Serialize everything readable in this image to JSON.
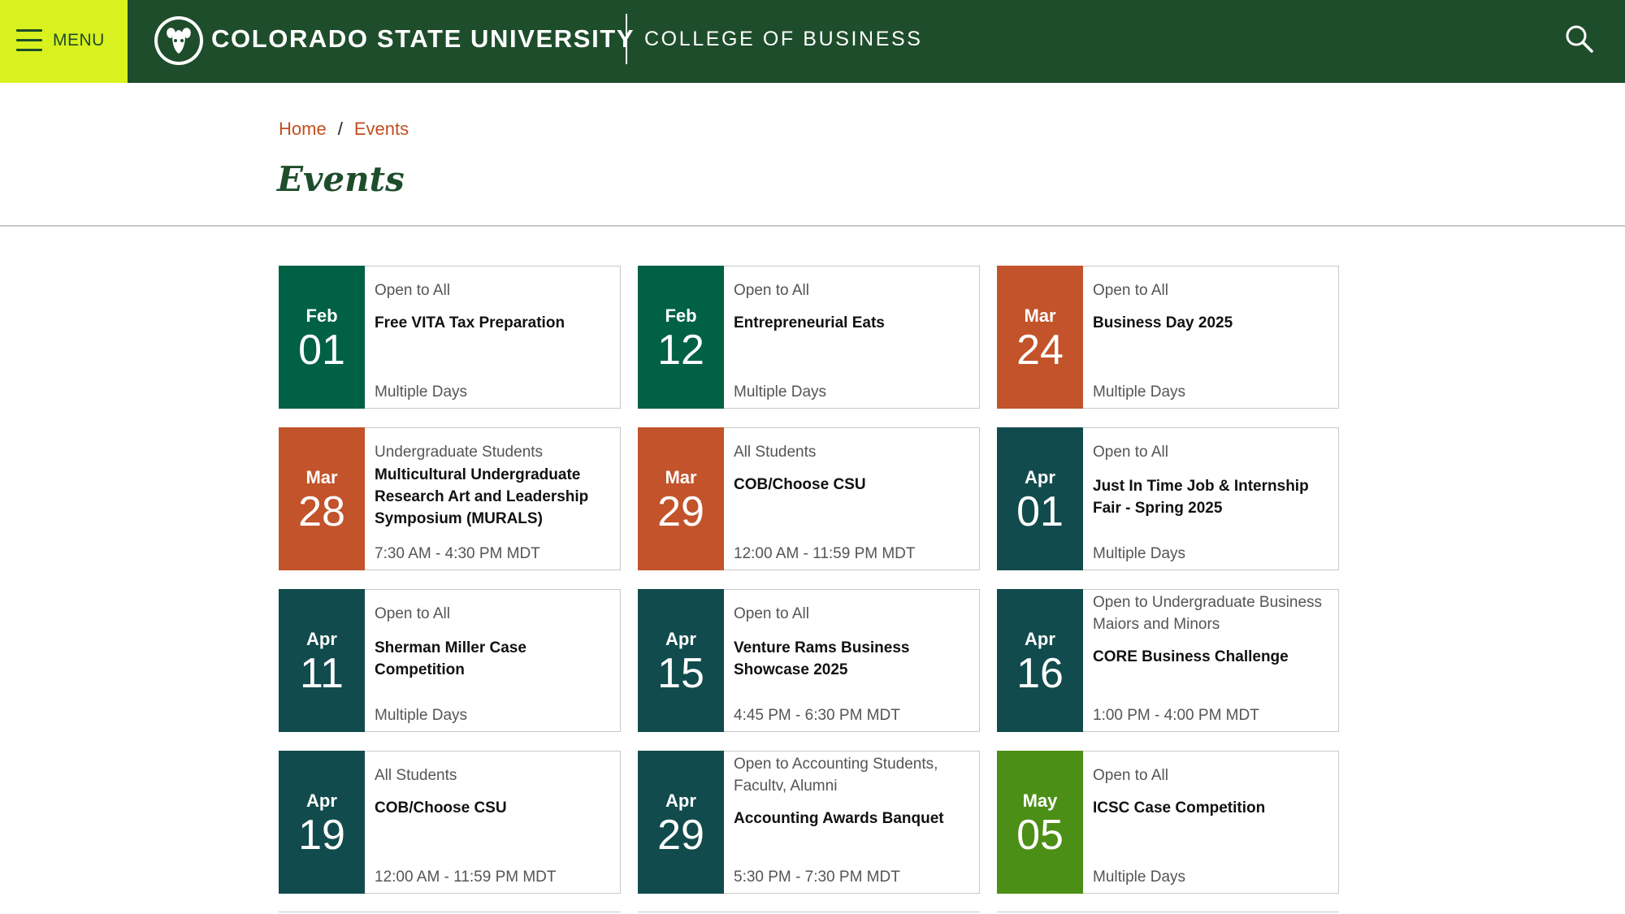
{
  "header": {
    "menu_label": "MENU",
    "university": "COLORADO STATE UNIVERSITY",
    "college": "COLLEGE OF BUSINESS",
    "icons": {
      "menu": "hamburger-icon",
      "logo": "ram-logo-icon",
      "search": "search-icon"
    },
    "colors": {
      "bar": "#1e4d2b",
      "menu_bg": "#d9f11e"
    }
  },
  "breadcrumb": {
    "home": "Home",
    "separator": "/",
    "current": "Events"
  },
  "page_title": "Events",
  "colors": {
    "green": "#006144",
    "orange": "#c2532a",
    "teal": "#124b4d",
    "lime": "#4c8f16"
  },
  "events": [
    {
      "month": "Feb",
      "day": "01",
      "audience": "Open to All",
      "title": "Free VITA Tax Preparation",
      "when": "Multiple Days",
      "color": "#006144"
    },
    {
      "month": "Feb",
      "day": "12",
      "audience": "Open to All",
      "title": "Entrepreneurial Eats",
      "when": "Multiple Days",
      "color": "#006144"
    },
    {
      "month": "Mar",
      "day": "24",
      "audience": "Open to All",
      "title": "Business Day 2025",
      "when": "Multiple Days",
      "color": "#c2532a"
    },
    {
      "month": "Mar",
      "day": "28",
      "audience": "Undergraduate Students",
      "title": "Multicultural Undergraduate Research Art and Leadership Symposium (MURALS)",
      "when": "7:30 AM - 4:30 PM MDT",
      "color": "#c2532a"
    },
    {
      "month": "Mar",
      "day": "29",
      "audience": "All Students",
      "title": "COB/Choose CSU",
      "when": "12:00 AM - 11:59 PM MDT",
      "color": "#c2532a"
    },
    {
      "month": "Apr",
      "day": "01",
      "audience": "Open to All",
      "title": "Just In Time Job & Internship Fair - Spring 2025",
      "when": "Multiple Days",
      "color": "#124b4d"
    },
    {
      "month": "Apr",
      "day": "11",
      "audience": "Open to All",
      "title": "Sherman Miller Case Competition",
      "when": "Multiple Days",
      "color": "#124b4d"
    },
    {
      "month": "Apr",
      "day": "15",
      "audience": "Open to All",
      "title": "Venture Rams Business Showcase 2025",
      "when": "4:45 PM - 6:30 PM MDT",
      "color": "#124b4d"
    },
    {
      "month": "Apr",
      "day": "16",
      "audience": "Open to Undergraduate Business Maiors and Minors",
      "title": "CORE Business Challenge",
      "when": "1:00 PM - 4:00 PM MDT",
      "color": "#124b4d"
    },
    {
      "month": "Apr",
      "day": "19",
      "audience": "All Students",
      "title": "COB/Choose CSU",
      "when": "12:00 AM - 11:59 PM MDT",
      "color": "#124b4d"
    },
    {
      "month": "Apr",
      "day": "29",
      "audience": "Open to Accounting Students, Facultv, Alumni",
      "title": "Accounting Awards Banquet",
      "when": "5:30 PM - 7:30 PM MDT",
      "color": "#124b4d"
    },
    {
      "month": "May",
      "day": "05",
      "audience": "Open to All",
      "title": "ICSC Case Competition",
      "when": "Multiple Days",
      "color": "#4c8f16"
    }
  ]
}
